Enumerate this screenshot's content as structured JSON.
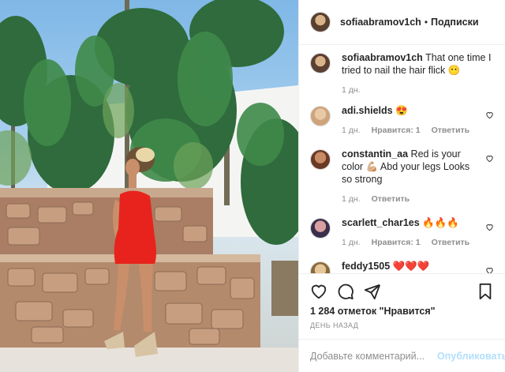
{
  "header": {
    "username": "sofiaabramov1ch",
    "separator": "•",
    "follow_label": "Подписки"
  },
  "caption": {
    "username": "sofiaabramov1ch",
    "text": "That one time I tried to nail the hair flick 😶",
    "time": "1 дн."
  },
  "comments": [
    {
      "username": "adi.shields",
      "text": "😍",
      "time": "1 дн.",
      "likes": "Нравится: 1",
      "reply": "Ответить"
    },
    {
      "username": "constantin_aa",
      "text": "Red is your color 💪🏼 Abd your legs Looks so strong",
      "time": "1 дн.",
      "reply": "Ответить"
    },
    {
      "username": "scarlett_char1es",
      "text": "🔥🔥🔥",
      "time": "1 дн.",
      "likes": "Нравится: 1",
      "reply": "Ответить"
    },
    {
      "username": "feddy1505",
      "text": "❤️❤️❤️"
    }
  ],
  "stats": {
    "likes_label": "1 284 отметок \"Нравится\"",
    "date_label": "ДЕНЬ НАЗАД"
  },
  "add_comment": {
    "placeholder": "Добавьте комментарий...",
    "publish_label": "Опубликовать"
  },
  "colors": {
    "accent_disabled": "#b2dffc",
    "dress": "#e8231d",
    "muted_text": "#8e8e8e"
  }
}
